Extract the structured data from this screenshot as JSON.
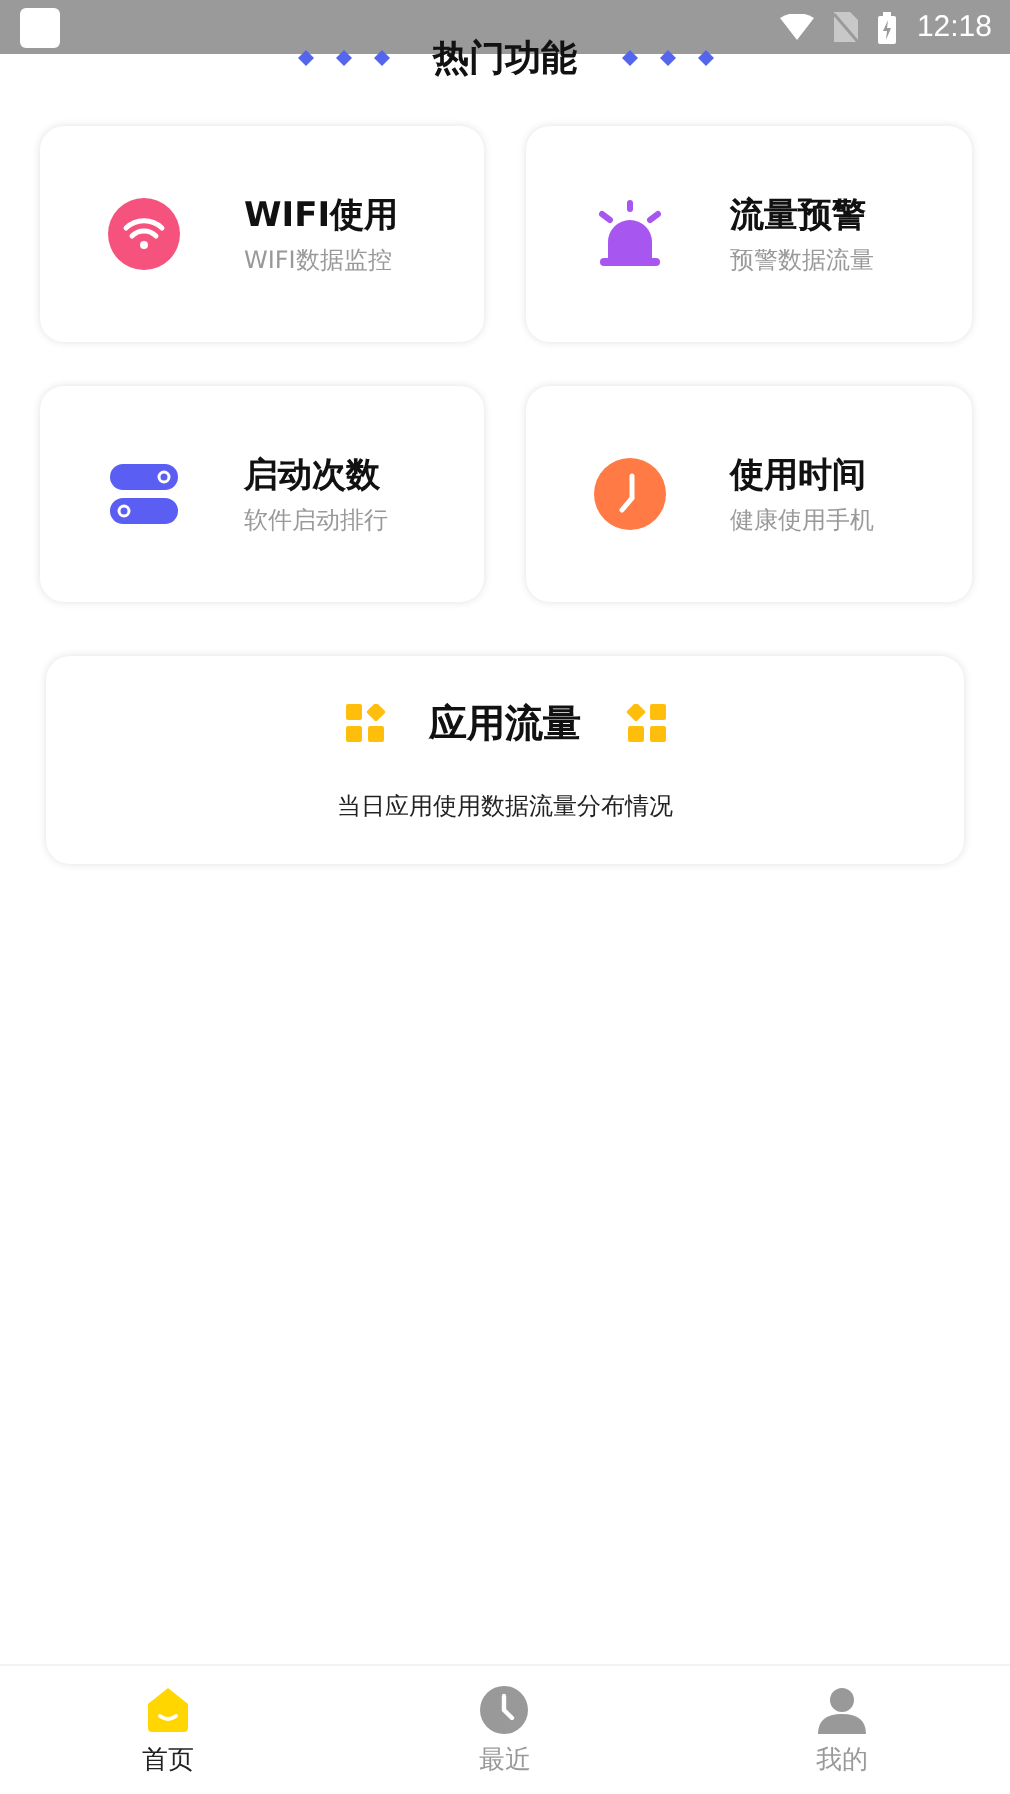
{
  "status_bar": {
    "time": "12:18"
  },
  "section_title": "热门功能",
  "features": [
    {
      "kind": "wifi",
      "title": "WIFI使用",
      "subtitle": "WIFI数据监控"
    },
    {
      "kind": "alarm",
      "title": "流量预警",
      "subtitle": "预警数据流量"
    },
    {
      "kind": "toggles",
      "title": "启动次数",
      "subtitle": "软件启动排行"
    },
    {
      "kind": "clock",
      "title": "使用时间",
      "subtitle": "健康使用手机"
    }
  ],
  "app_traffic": {
    "title": "应用流量",
    "subtitle": "当日应用使用数据流量分布情况"
  },
  "tabs": [
    {
      "kind": "home",
      "label": "首页",
      "selected": true
    },
    {
      "kind": "recent",
      "label": "最近",
      "selected": false
    },
    {
      "kind": "me",
      "label": "我的",
      "selected": false
    }
  ]
}
